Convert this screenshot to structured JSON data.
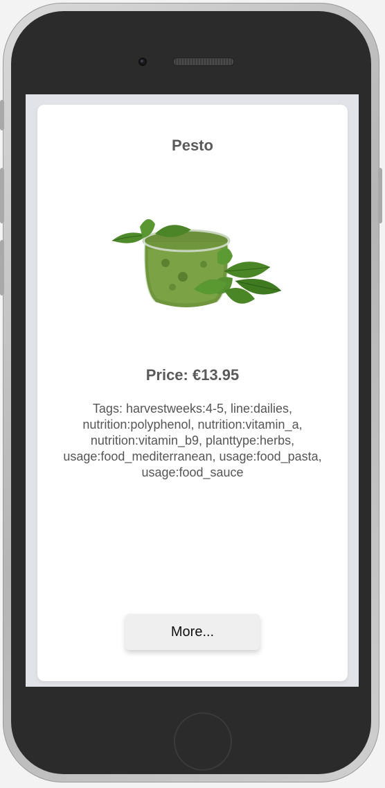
{
  "product": {
    "title": "Pesto",
    "image_alt": "jar of pesto with basil leaves",
    "price": "Price: €13.95",
    "tags": "Tags: harvestweeks:4-5, line:dailies, nutrition:polyphenol, nutrition:vitamin_a, nutrition:vitamin_b9, planttype:herbs, usage:food_mediterranean, usage:food_pasta, usage:food_sauce"
  },
  "actions": {
    "more_label": "More..."
  },
  "colors": {
    "text": "#5a5a5a",
    "card": "#ffffff",
    "screen_bg": "#e2e3e8",
    "phone_body": "#2b2b2b",
    "button_bg": "#efefef"
  },
  "icons": {
    "image": "pesto-jar-image"
  }
}
